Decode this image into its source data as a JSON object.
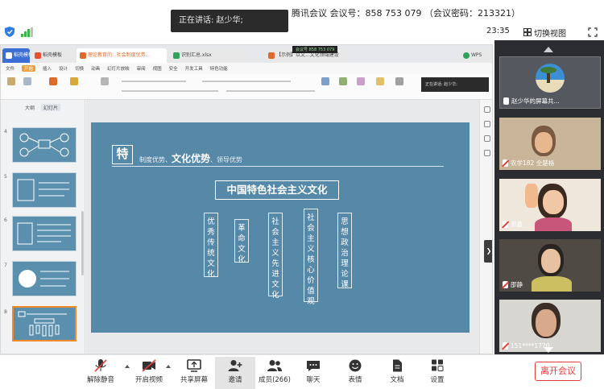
{
  "meeting": {
    "speaking_label": "正在讲话: 赵少华;",
    "info": "腾讯会议 会议号：858 753 079 （会议密码：213321）",
    "time": "23:35",
    "switch_view": "切换视图"
  },
  "browser": {
    "tabs": [
      "稻壳模板",
      "理论教育的...社会制度优势...",
      "识别汇总.xlsx",
      "【示例】以文...文化领域建设",
      "WPS"
    ],
    "recording": "会议号 858 753 079",
    "speaker_tip": "正在讲话: 赵少华;"
  },
  "ribbon": {
    "menu": [
      "文件",
      "开始",
      "插入",
      "设计",
      "切换",
      "动画",
      "幻灯片放映",
      "审阅",
      "视图",
      "安全",
      "开发工具",
      "特色功能"
    ],
    "active_menu": "开始"
  },
  "slide_panel": {
    "tab_outline": "大纲",
    "tab_slides": "幻灯片",
    "thumb_numbers": [
      "4",
      "5",
      "6",
      "7",
      "8"
    ],
    "add_label": "+"
  },
  "slide": {
    "mark": "特",
    "subtitle_a": "制度优势、",
    "subtitle_b": "文化优势",
    "subtitle_c": "、领导优势",
    "title": "中国特色社会主义文化",
    "items": [
      "优秀传统文化",
      "革命文化",
      "社会主义先进文化",
      "社会主义核心价值观",
      "思想政治理论课"
    ]
  },
  "participants": [
    {
      "name": "赵少华的屏幕共...",
      "muted": false,
      "active": true
    },
    {
      "name": "农学182 全楚格",
      "muted": true,
      "active": false
    },
    {
      "name": "郭鑫",
      "muted": true,
      "active": false
    },
    {
      "name": "邵静",
      "muted": true,
      "active": false
    },
    {
      "name": "151****1770",
      "muted": true,
      "active": false
    }
  ],
  "controls": {
    "mute": "解除静音",
    "video": "开启视频",
    "share": "共享屏幕",
    "invite": "邀请",
    "members": "成员(266)",
    "chat": "聊天",
    "reactions": "表情",
    "docs": "文档",
    "settings": "设置",
    "leave": "离开会议"
  },
  "colors": {
    "slide_bg": "#5688a8",
    "leave": "#e23b3b",
    "selected_thumb": "#f08a2a"
  }
}
